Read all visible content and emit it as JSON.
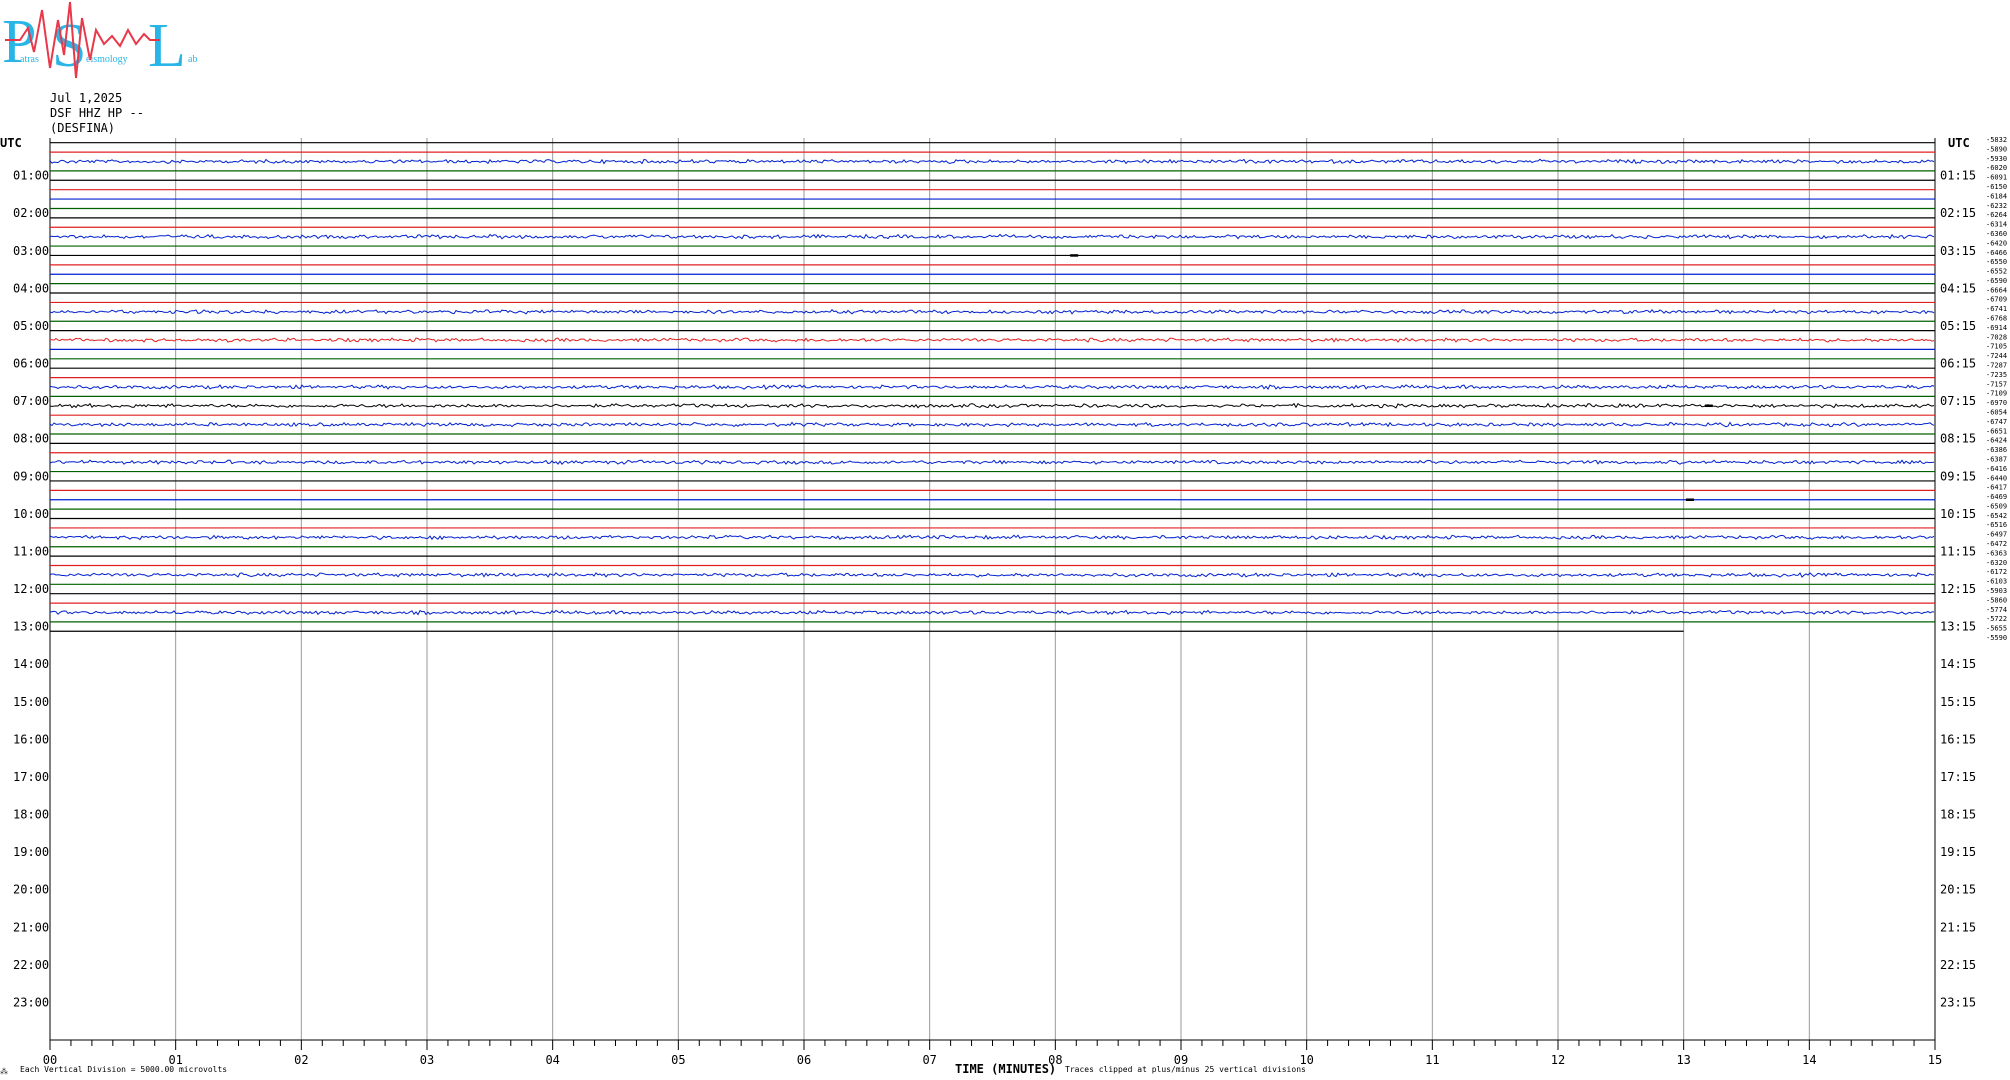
{
  "logo": {
    "big_letters": [
      "P",
      "S",
      "L"
    ],
    "small_text": [
      "atras",
      "eismology",
      "ab"
    ],
    "letter_color": "#29b6e6",
    "wave_color": "#e8384a"
  },
  "header": {
    "date": "Jul 1,2025",
    "channel": "DSF HHZ HP --",
    "station": "(DESFINA)"
  },
  "left_axis_title": "UTC",
  "right_axis_title": "UTC",
  "chart_data": {
    "type": "line",
    "x_label": "TIME (MINUTES)",
    "x_ticks": [
      "00",
      "01",
      "02",
      "03",
      "04",
      "05",
      "06",
      "07",
      "08",
      "09",
      "10",
      "11",
      "12",
      "13",
      "14",
      "15"
    ],
    "x_range": [
      0,
      15
    ],
    "hour_labels_left": [
      "01:00",
      "02:00",
      "03:00",
      "04:00",
      "05:00",
      "06:00",
      "07:00",
      "08:00",
      "09:00",
      "10:00",
      "11:00",
      "12:00",
      "13:00",
      "14:00",
      "15:00",
      "16:00",
      "17:00",
      "18:00",
      "19:00",
      "20:00",
      "21:00",
      "22:00",
      "23:00"
    ],
    "hour_labels_right": [
      "01:15",
      "02:15",
      "03:15",
      "04:15",
      "05:15",
      "06:15",
      "07:15",
      "08:15",
      "09:15",
      "10:15",
      "11:15",
      "12:15",
      "13:15",
      "14:15",
      "15:15",
      "16:15",
      "17:15",
      "18:15",
      "19:15",
      "20:15",
      "21:15",
      "22:15",
      "23:15"
    ],
    "trace_colors": [
      "#000000",
      "#e02020",
      "#0020d0",
      "#006000"
    ],
    "rows_per_hour": 4,
    "total_traces": 53,
    "last_trace_end_minute": 13,
    "trace_offsets": [
      "-5832",
      "-5890",
      "-5930",
      "-6020",
      "-6091",
      "-6150",
      "-6184",
      "-6232",
      "-6264",
      "-6314",
      "-6360",
      "-6420",
      "-6466",
      "-6550",
      "-6552",
      "-6590",
      "-6664",
      "-6709",
      "-6741",
      "-6768",
      "-6914",
      "-7028",
      "-7105",
      "-7244",
      "-7287",
      "-7235",
      "-7157",
      "-7109",
      "-6970",
      "-6054",
      "-6747",
      "-6651",
      "-6424",
      "-6386",
      "-6387",
      "-6416",
      "-6440",
      "-6417",
      "-6469",
      "-6509",
      "-6542",
      "-6516",
      "-6497",
      "-6472",
      "-6363",
      "-6320",
      "-6172",
      "-6103",
      "-5903",
      "-5860",
      "-5774",
      "-5722",
      "-5655",
      "-5590"
    ],
    "noisy_traces": [
      2,
      10,
      18,
      21,
      26,
      28,
      30,
      34,
      42,
      46,
      50
    ],
    "events": [
      {
        "trace": 12,
        "minute": 8.15
      },
      {
        "trace": 28,
        "minute": 13.2
      },
      {
        "trace": 38,
        "minute": 13.05
      }
    ]
  },
  "footer": {
    "scale_note": "Each Vertical Division = 5000.00 microvolts",
    "clip_note": "Traces clipped at plus/minus 25 vertical divisions",
    "corner_mark": "⁂"
  }
}
